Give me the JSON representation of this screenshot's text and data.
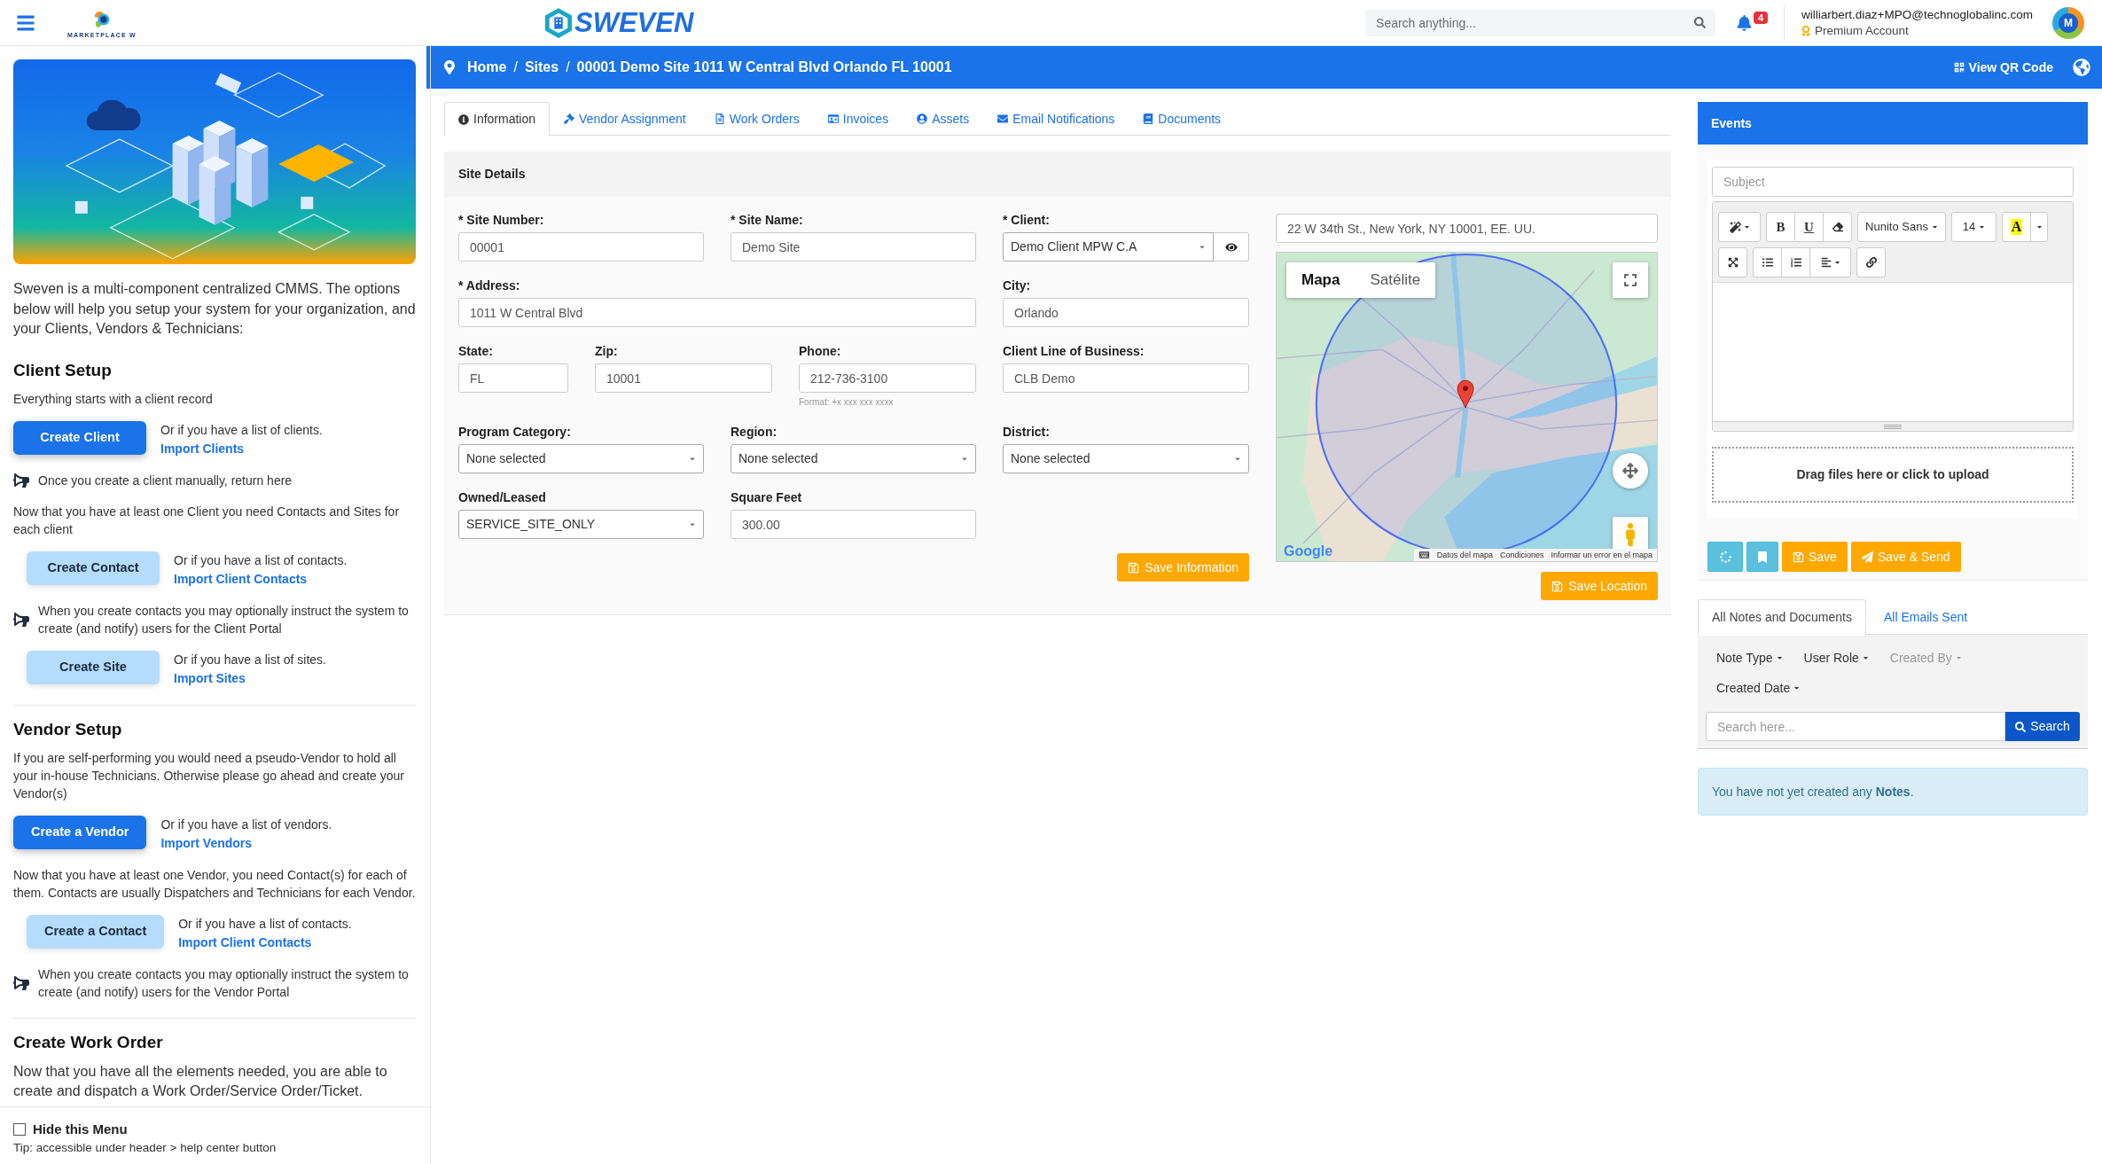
{
  "header": {
    "brand": "MARKETPLACE W",
    "logo": "SWEVEN",
    "search": {
      "placeholder": "Search anything..."
    },
    "notification_count": "4",
    "user": {
      "email": "williarbert.diaz+MPO@technoglobalinc.com",
      "plan": "Premium Account",
      "avatar": "M"
    }
  },
  "sidebar": {
    "intro": "Sweven is a multi-component centralized CMMS. The options below will help you setup your system for your organization, and your Clients, Vendors & Technicians:",
    "sections": [
      {
        "title": "Client Setup",
        "items": [
          {
            "kind": "text",
            "text": "Everything starts with a client record"
          },
          {
            "kind": "primary_action",
            "button": "Create Client",
            "note": "Or if you have a list of clients.",
            "link": "Import Clients"
          },
          {
            "kind": "notice",
            "text": "Once you create a client manually, return here"
          },
          {
            "kind": "text",
            "text": "Now that you have at least one Client you need Contacts and Sites for each client"
          },
          {
            "kind": "light_action",
            "button": "Create Contact",
            "note": "Or if you have a list of contacts.",
            "link": "Import Client Contacts"
          },
          {
            "kind": "notice",
            "text": "When you create contacts you may optionally instruct the system to create (and notify) users for the Client Portal"
          },
          {
            "kind": "light_action",
            "button": "Create Site",
            "note": "Or if you have a list of sites.",
            "link": "Import Sites"
          }
        ]
      },
      {
        "title": "Vendor Setup",
        "items": [
          {
            "kind": "text",
            "text": "If you are self-performing you would need a pseudo-Vendor to hold all your in-house Technicians. Otherwise please go ahead and create your Vendor(s)"
          },
          {
            "kind": "primary_action",
            "button": "Create a Vendor",
            "note": "Or if you have a list of vendors.",
            "link": "Import Vendors"
          },
          {
            "kind": "text",
            "text": "Now that you have at least one Vendor, you need Contact(s) for each of them. Contacts are usually Dispatchers and Technicians for each Vendor."
          },
          {
            "kind": "light_action",
            "button": "Create a Contact",
            "note": "Or if you have a list of contacts.",
            "link": "Import Client Contacts"
          },
          {
            "kind": "notice",
            "text": "When you create contacts you may optionally instruct the system to create (and notify) users for the Vendor Portal"
          }
        ]
      },
      {
        "title": "Create Work Order",
        "items": [
          {
            "kind": "lead",
            "text": "Now that you have all the elements needed, you are able to create and dispatch a Work Order/Service Order/Ticket."
          }
        ]
      }
    ],
    "footer": {
      "hide_menu": {
        "label": "Hide this Menu",
        "checked": false
      },
      "tip": "Tip: accessible under header > help center button"
    }
  },
  "breadcrumb": {
    "separator": "/",
    "items": [
      "Home",
      "Sites",
      "00001 Demo Site 1011 W Central Blvd Orlando FL 10001"
    ],
    "qr_button": "View QR Code"
  },
  "tabs": [
    {
      "label": "Information",
      "selected": true
    },
    {
      "label": "Vendor Assignment",
      "selected": false
    },
    {
      "label": "Work Orders",
      "selected": false
    },
    {
      "label": "Invoices",
      "selected": false
    },
    {
      "label": "Assets",
      "selected": false
    },
    {
      "label": "Email Notifications",
      "selected": false
    },
    {
      "label": "Documents",
      "selected": false
    }
  ],
  "site_details": {
    "title": "Site Details",
    "fields": [
      {
        "label": "* Site Number:",
        "kind": "text",
        "value": "00001"
      },
      {
        "label": "* Site Name:",
        "kind": "text",
        "value": "Demo Site"
      },
      {
        "label": "* Client:",
        "kind": "select_view",
        "value": "Demo Client MPW C.A"
      },
      {
        "label": "* Address:",
        "kind": "text",
        "value": "1011 W Central Blvd"
      },
      {
        "label": "City:",
        "kind": "text",
        "value": "Orlando"
      },
      {
        "label": "State:",
        "kind": "text",
        "value": "FL"
      },
      {
        "label": "Zip:",
        "kind": "text",
        "value": "10001"
      },
      {
        "label": "Phone:",
        "kind": "text",
        "value": "212-736-3100",
        "hint": "Format: +x xxx xxx xxxx"
      },
      {
        "label": "Client Line of Business:",
        "kind": "text",
        "value": "CLB Demo"
      },
      {
        "label": "Program Category:",
        "kind": "select",
        "value": "None selected"
      },
      {
        "label": "Region:",
        "kind": "select",
        "value": "None selected"
      },
      {
        "label": "District:",
        "kind": "select",
        "value": "None selected"
      },
      {
        "label": "Owned/Leased",
        "kind": "select",
        "value": "SERVICE_SITE_ONLY"
      },
      {
        "label": "Square Feet",
        "kind": "text",
        "value": "300.00"
      }
    ],
    "save_button": "Save Information"
  },
  "location": {
    "address": "22 W 34th St., New York, NY 10001, EE. UU.",
    "map": {
      "types": [
        {
          "label": "Mapa",
          "selected": true
        },
        {
          "label": "Satélite",
          "selected": false
        }
      ],
      "logo": "Google",
      "attribution": [
        "Datos del mapa",
        "Condiciones",
        "Informar un error en el mapa"
      ]
    },
    "save_button": "Save Location"
  },
  "events": {
    "title": "Events",
    "subject": {
      "placeholder": "Subject"
    },
    "toolbar": {
      "bold": "B",
      "underline": "U",
      "font": "Nunito Sans",
      "size": "14",
      "highlight": "A"
    },
    "dropzone": "Drag files here or click to upload",
    "buttons": [
      "Save",
      "Save & Send"
    ]
  },
  "notes": {
    "tabs": [
      {
        "label": "All Notes and Documents",
        "selected": true
      },
      {
        "label": "All Emails Sent",
        "selected": false
      }
    ],
    "filters": [
      {
        "label": "Note Type",
        "disabled": false
      },
      {
        "label": "User Role",
        "disabled": false
      },
      {
        "label": "Created By",
        "disabled": true
      },
      {
        "label": "Created Date",
        "disabled": false
      }
    ],
    "search": {
      "placeholder": "Search here...",
      "button": "Search"
    },
    "message": "You have not yet created any **Notes**."
  }
}
